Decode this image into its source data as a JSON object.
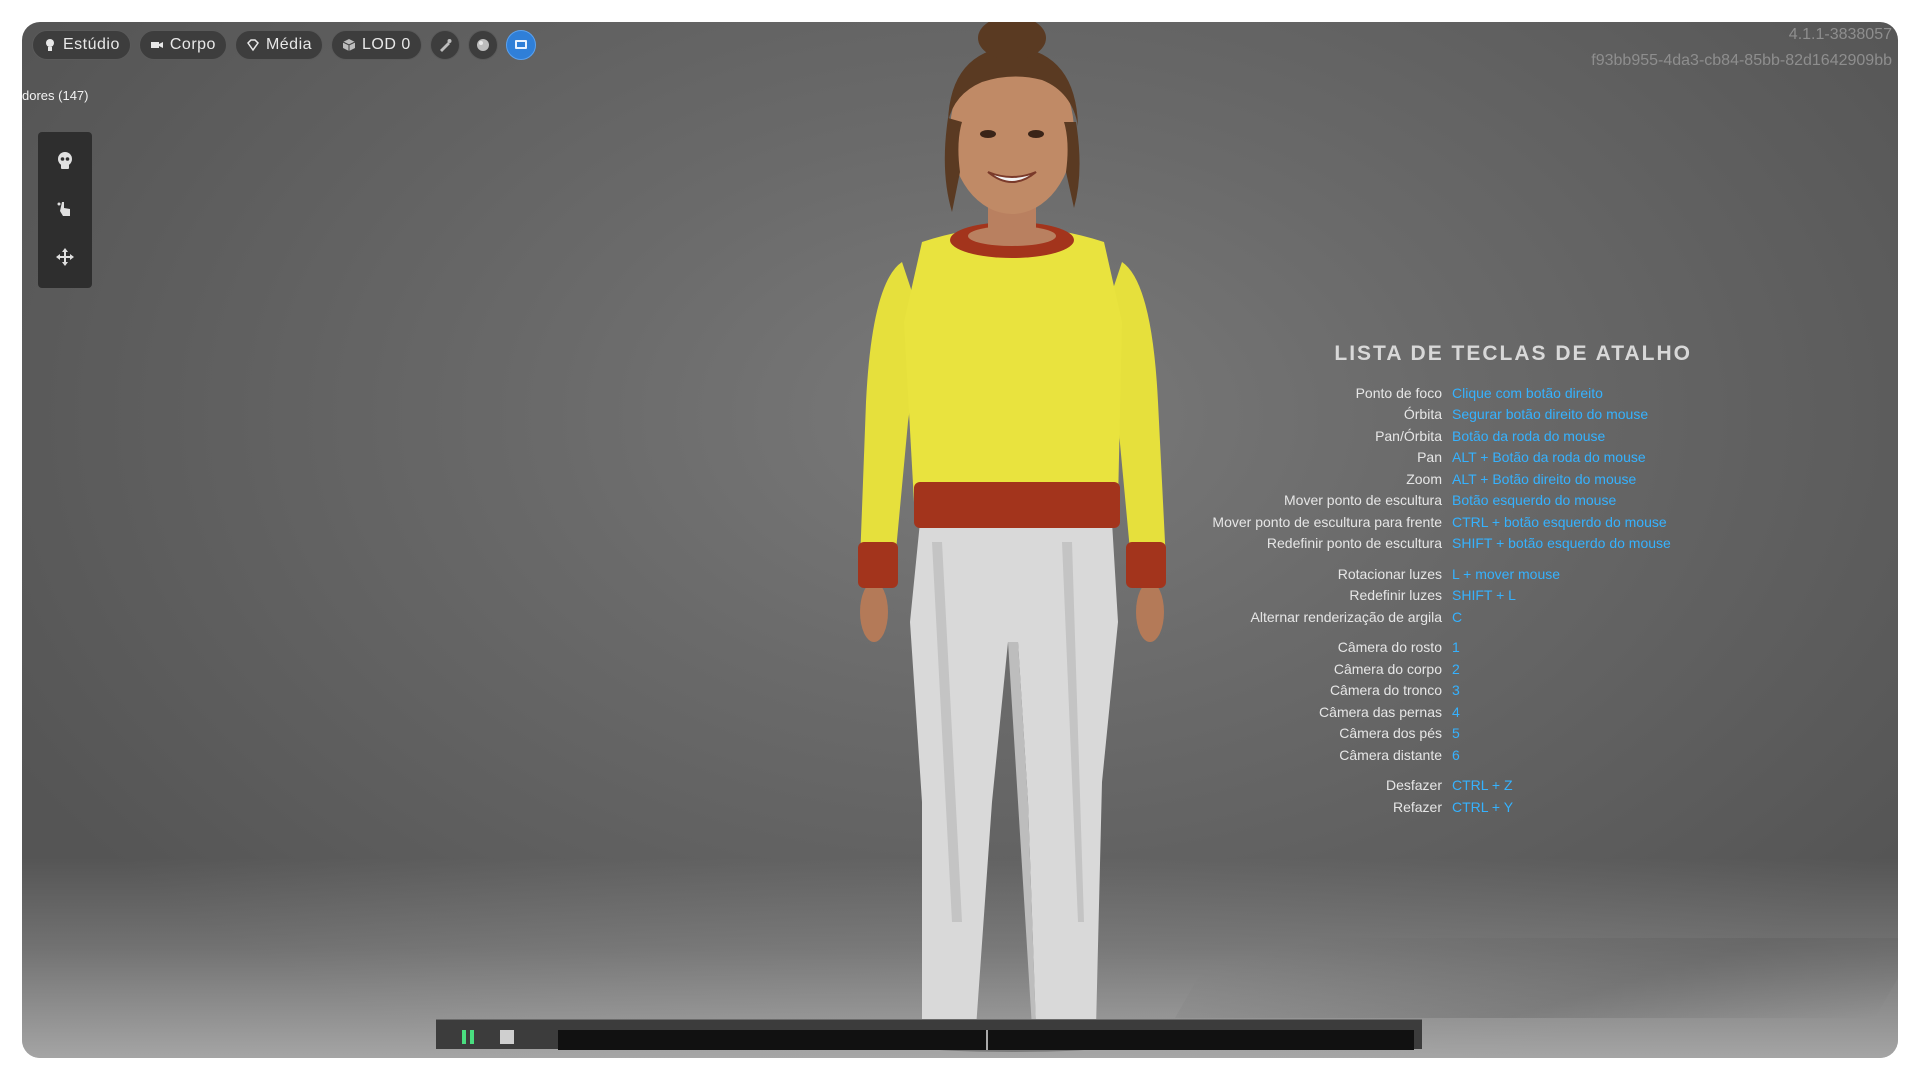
{
  "toolbar": {
    "buttons": [
      {
        "label": "Estúdio",
        "icon": "bulb-icon"
      },
      {
        "label": "Corpo",
        "icon": "camera-icon"
      },
      {
        "label": "Média",
        "icon": "diamond-icon"
      },
      {
        "label": "LOD 0",
        "icon": "cube-icon"
      }
    ],
    "round_buttons": [
      "brush-icon",
      "sphere-icon",
      "display-icon"
    ],
    "active_color": "#2f7fd8"
  },
  "version": {
    "line1": "4.1.1-3838057",
    "line2": "f93bb955-4da3-cb84-85bb-82d1642909bb"
  },
  "breadcrumb": {
    "title": "dores (147)"
  },
  "side_tools": [
    "skull-icon",
    "hand-pointer-icon",
    "move-icon"
  ],
  "shortcuts": {
    "title": "LISTA DE TECLAS DE ATALHO",
    "key_color": "#35b2ff",
    "groups": [
      [
        {
          "label": "Ponto de foco",
          "key": "Clique com botão direito"
        },
        {
          "label": "Órbita",
          "key": "Segurar botão direito do mouse"
        },
        {
          "label": "Pan/Órbita",
          "key": "Botão da roda do mouse"
        },
        {
          "label": "Pan",
          "key": "ALT + Botão da roda do mouse"
        },
        {
          "label": "Zoom",
          "key": "ALT + Botão direito do mouse"
        },
        {
          "label": "Mover ponto de escultura",
          "key": "Botão esquerdo do mouse"
        },
        {
          "label": "Mover ponto de escultura para frente",
          "key": "CTRL + botão esquerdo do mouse"
        },
        {
          "label": "Redefinir ponto de escultura",
          "key": "SHIFT + botão esquerdo do mouse"
        }
      ],
      [
        {
          "label": "Rotacionar luzes",
          "key": "L + mover mouse"
        },
        {
          "label": "Redefinir luzes",
          "key": "SHIFT + L"
        },
        {
          "label": "Alternar renderização de argila",
          "key": "C"
        }
      ],
      [
        {
          "label": "Câmera do rosto",
          "key": "1"
        },
        {
          "label": "Câmera do corpo",
          "key": "2"
        },
        {
          "label": "Câmera do tronco",
          "key": "3"
        },
        {
          "label": "Câmera das pernas",
          "key": "4"
        },
        {
          "label": "Câmera dos pés",
          "key": "5"
        },
        {
          "label": "Câmera distante",
          "key": "6"
        }
      ],
      [
        {
          "label": "Desfazer",
          "key": "CTRL + Z"
        },
        {
          "label": "Refazer",
          "key": "CTRL + Y"
        }
      ]
    ]
  },
  "timeline": {
    "play_color": "#4ade80",
    "playhead_fraction": 0.5
  }
}
